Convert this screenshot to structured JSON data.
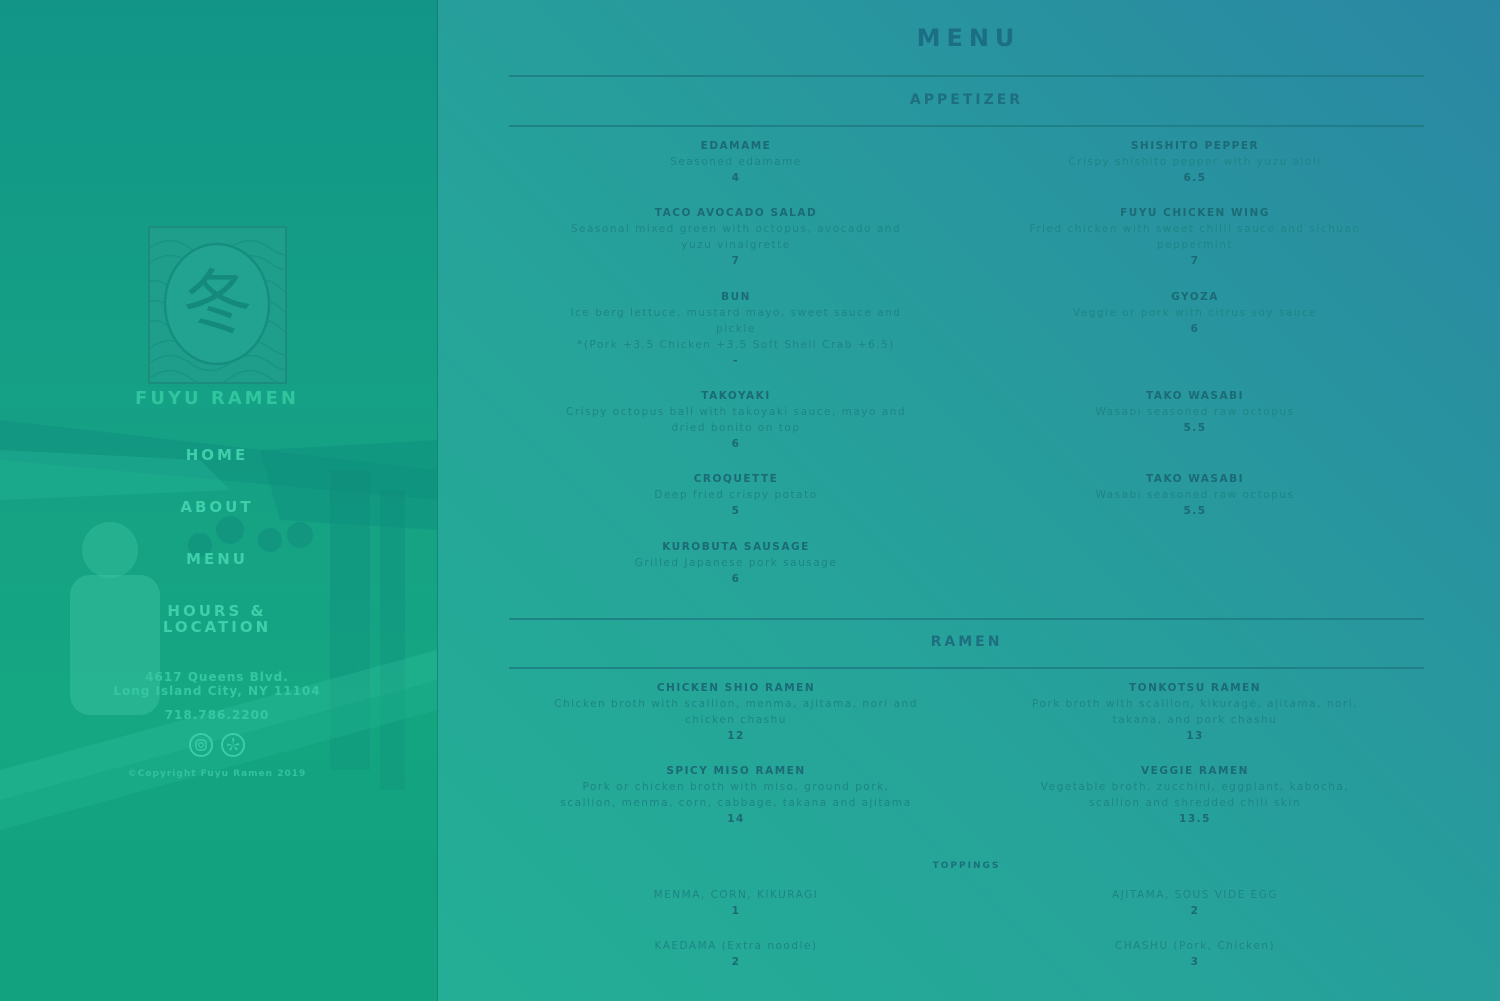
{
  "sidebar": {
    "brand": "FUYU RAMEN",
    "logo_glyph": "冬",
    "nav": [
      {
        "label": "HOME"
      },
      {
        "label": "ABOUT"
      },
      {
        "label": "MENU"
      },
      {
        "label": "HOURS &",
        "label2": "LOCATION"
      }
    ],
    "address_line1": "4617 Queens Blvd.",
    "address_line2": "Long Island City, NY 11104",
    "phone": "718.786.2200",
    "social": [
      "instagram-icon",
      "yelp-icon"
    ],
    "copyright": "©Copyright Fuyu Ramen 2019"
  },
  "main": {
    "title": "MENU",
    "appetizer": {
      "title": "APPETIZER",
      "items": [
        {
          "name": "EDAMAME",
          "desc": "Seasoned edamame",
          "price": "4"
        },
        {
          "name": "SHISHITO PEPPER",
          "desc": "Crispy shishito pepper with yuzu aioli",
          "price": "6.5"
        },
        {
          "name": "TACO AVOCADO SALAD",
          "desc": "Seasonal mixed green with octopus, avocado and yuzu vinaigrette",
          "price": "7"
        },
        {
          "name": "FUYU CHICKEN WING",
          "desc": "Fried chicken with sweet chilli sauce and sichuan peppermint",
          "price": "7"
        },
        {
          "name": "BUN",
          "desc": "Ice berg lettuce, mustard mayo, sweet sauce and pickle",
          "desc2": "*(Pork +3.5 Chicken +3.5 Soft Shell Crab +6.5)",
          "price": "-"
        },
        {
          "name": "GYOZA",
          "desc": "Veggie or pork with citrus soy sauce",
          "price": "6"
        },
        {
          "name": "TAKOYAKI",
          "desc": "Crispy octopus ball with takoyaki sauce, mayo and dried bonito on top",
          "price": "6"
        },
        {
          "name": "TAKO WASABI",
          "desc": "Wasabi seasoned raw octopus",
          "price": "5.5"
        },
        {
          "name": "CROQUETTE",
          "desc": "Deep fried crispy potato",
          "price": "5"
        },
        {
          "name": "TAKO WASABI",
          "desc": "Wasabi seasoned raw octopus",
          "price": "5.5"
        },
        {
          "name": "KUROBUTA SAUSAGE",
          "desc": "Grilled Japanese pork sausage",
          "price": "6"
        }
      ]
    },
    "ramen": {
      "title": "RAMEN",
      "items": [
        {
          "name": "CHICKEN SHIO RAMEN",
          "desc": "Chicken broth with scallion, menma, ajitama, nori and chicken chashu",
          "price": "12"
        },
        {
          "name": "TONKOTSU RAMEN",
          "desc": "Pork broth with scallion, kikurage, ajitama, nori, takana, and pork chashu",
          "price": "13"
        },
        {
          "name": "SPICY MISO RAMEN",
          "desc": "Pork or chicken broth with miso, ground pork, scallion, menma, corn, cabbage, takana and ajitama",
          "price": "14"
        },
        {
          "name": "VEGGIE RAMEN",
          "desc": "Vegetable broth, zucchini, eggplant, kabocha, scallion and shredded chili skin",
          "price": "13.5"
        }
      ]
    },
    "toppings": {
      "title": "TOPPINGS",
      "items": [
        {
          "name": "MENMA, CORN, KIKURAGI",
          "price": "1"
        },
        {
          "name": "AJITAMA, SOUS VIDE EGG",
          "price": "2"
        },
        {
          "name": "KAEDAMA (Extra noodle)",
          "price": "2"
        },
        {
          "name": "CHASHU (Pork, Chicken)",
          "price": "3"
        }
      ]
    }
  }
}
